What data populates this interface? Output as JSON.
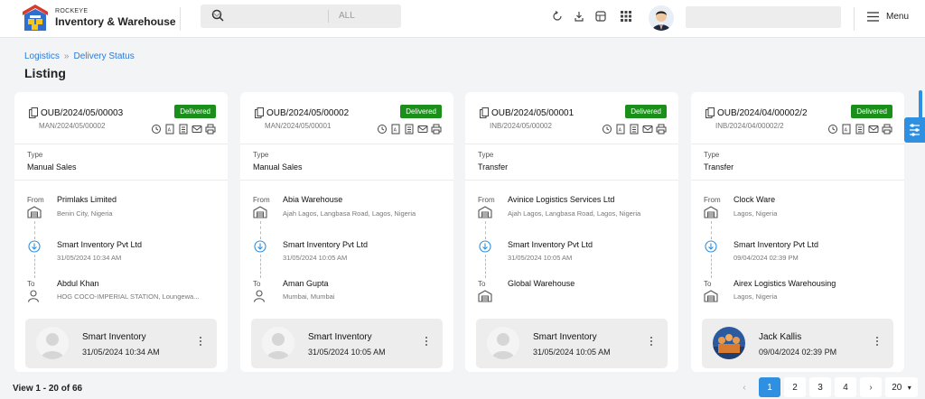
{
  "brand": {
    "small": "ROCKEYE",
    "name": "Inventory & Warehouse"
  },
  "search": {
    "filter": "ALL",
    "placeholder": ""
  },
  "menu": {
    "label": "Menu"
  },
  "breadcrumb": {
    "first": "Logistics",
    "second": "Delivery Status"
  },
  "page": {
    "title": "Listing"
  },
  "cards": [
    {
      "doc": "OUB/2024/05/00003",
      "ref": "MAN/2024/05/00002",
      "status": "Delivered",
      "type_label": "Type",
      "type": "Manual Sales",
      "from_label": "From",
      "from_name": "Primlaks Limited",
      "from_addr": "Benin City, Nigeria",
      "via_name": "Smart Inventory Pvt Ltd",
      "via_time": "31/05/2024 10:34 AM",
      "to_label": "To",
      "to_name": "Abdul Khan",
      "to_addr": "HOG COCO-IMPERIAL STATION, Loungewa...",
      "footer_name": "Smart Inventory",
      "footer_time": "31/05/2024 10:34 AM",
      "footer_avatar": "placeholder",
      "to_icon": "person-icon"
    },
    {
      "doc": "OUB/2024/05/00002",
      "ref": "MAN/2024/05/00001",
      "status": "Delivered",
      "type_label": "Type",
      "type": "Manual Sales",
      "from_label": "From",
      "from_name": "Abia Warehouse",
      "from_addr": "Ajah Lagos, Langbasa Road, Lagos, Nigeria",
      "via_name": "Smart Inventory Pvt Ltd",
      "via_time": "31/05/2024 10:05 AM",
      "to_label": "To",
      "to_name": "Aman Gupta",
      "to_addr": "Mumbai, Mumbai",
      "footer_name": "Smart Inventory",
      "footer_time": "31/05/2024 10:05 AM",
      "footer_avatar": "placeholder",
      "to_icon": "person-icon"
    },
    {
      "doc": "OUB/2024/05/00001",
      "ref": "INB/2024/05/00002",
      "status": "Delivered",
      "type_label": "Type",
      "type": "Transfer",
      "from_label": "From",
      "from_name": "Avinice Logistics Services Ltd",
      "from_addr": "Ajah Lagos, Langbasa Road, Lagos, Nigeria",
      "via_name": "Smart Inventory Pvt Ltd",
      "via_time": "31/05/2024 10:05 AM",
      "to_label": "To",
      "to_name": "Global Warehouse",
      "to_addr": "",
      "footer_name": "Smart Inventory",
      "footer_time": "31/05/2024 10:05 AM",
      "footer_avatar": "placeholder",
      "to_icon": "warehouse-icon"
    },
    {
      "doc": "OUB/2024/04/00002/2",
      "ref": "INB/2024/04/00002/2",
      "status": "Delivered",
      "type_label": "Type",
      "type": "Transfer",
      "from_label": "From",
      "from_name": "Clock Ware",
      "from_addr": "Lagos, Nigeria",
      "via_name": "Smart Inventory Pvt Ltd",
      "via_time": "09/04/2024 02:39 PM",
      "to_label": "To",
      "to_name": "Airex Logistics Warehousing",
      "to_addr": "Lagos, Nigeria",
      "footer_name": "Jack Kallis",
      "footer_time": "09/04/2024 02:39 PM",
      "footer_avatar": "photo",
      "to_icon": "warehouse-icon"
    }
  ],
  "pagination": {
    "summary": "View 1 - 20 of 66",
    "pages": [
      "1",
      "2",
      "3",
      "4"
    ],
    "current": "1",
    "page_size": "20"
  },
  "colors": {
    "accent": "#2f8fe0",
    "delivered": "#1a8f1a"
  }
}
